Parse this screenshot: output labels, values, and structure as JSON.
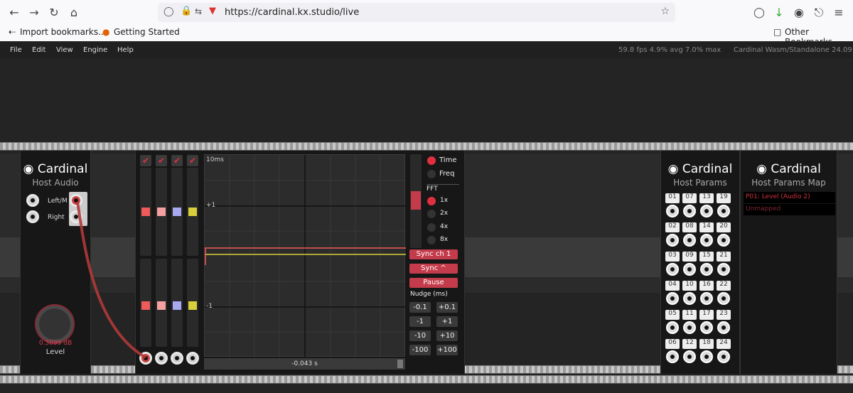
{
  "browser": {
    "url": "https://cardinal.kx.studio/live",
    "bookmarks": [
      "Import bookmarks...",
      "Getting Started"
    ],
    "other_bookmarks": "Other Bookmarks",
    "nav_icons": [
      "back-icon",
      "forward-icon",
      "reload-icon",
      "home-icon"
    ]
  },
  "app": {
    "menu": [
      "File",
      "Edit",
      "View",
      "Engine",
      "Help"
    ],
    "stats": "59.8 fps  4.9% avg  7.0% max",
    "version": "Cardinal Wasm/Standalone 24.09"
  },
  "host_audio": {
    "title": "Cardinal",
    "subtitle": "Host Audio",
    "left_label": "Left/M",
    "right_label": "Right",
    "level_value": "0.3099 dB",
    "level_label": "Level"
  },
  "scope": {
    "time_label": "10ms",
    "plus1": "+1",
    "minus1": "-1",
    "position": "-0.043 s",
    "channel_colors": [
      "#ef5a5a",
      "#f4a0a0",
      "#a8a8f0",
      "#d9cf3a"
    ],
    "options": {
      "time": "Time",
      "freq": "Freq",
      "fft": "FFT",
      "fft_1x": "1x",
      "fft_2x": "2x",
      "fft_4x": "4x",
      "fft_8x": "8x"
    },
    "buttons": {
      "sync_ch": "Sync ch 1",
      "sync": "Sync ^",
      "pause": "Pause",
      "nudge_label": "Nudge (ms)",
      "nudge": [
        "-0.1",
        "+0.1",
        "-1",
        "+1",
        "-10",
        "+10",
        "-100",
        "+100"
      ]
    }
  },
  "host_params": {
    "title": "Cardinal",
    "subtitle": "Host Params",
    "numbers": [
      "01",
      "07",
      "13",
      "19",
      "02",
      "08",
      "14",
      "20",
      "03",
      "09",
      "15",
      "21",
      "04",
      "10",
      "16",
      "22",
      "05",
      "11",
      "17",
      "23",
      "06",
      "12",
      "18",
      "24"
    ]
  },
  "host_params_map": {
    "title": "Cardinal",
    "subtitle": "Host Params Map",
    "entry": "P01: Level (Audio 2)",
    "unmapped": "Unmapped"
  }
}
